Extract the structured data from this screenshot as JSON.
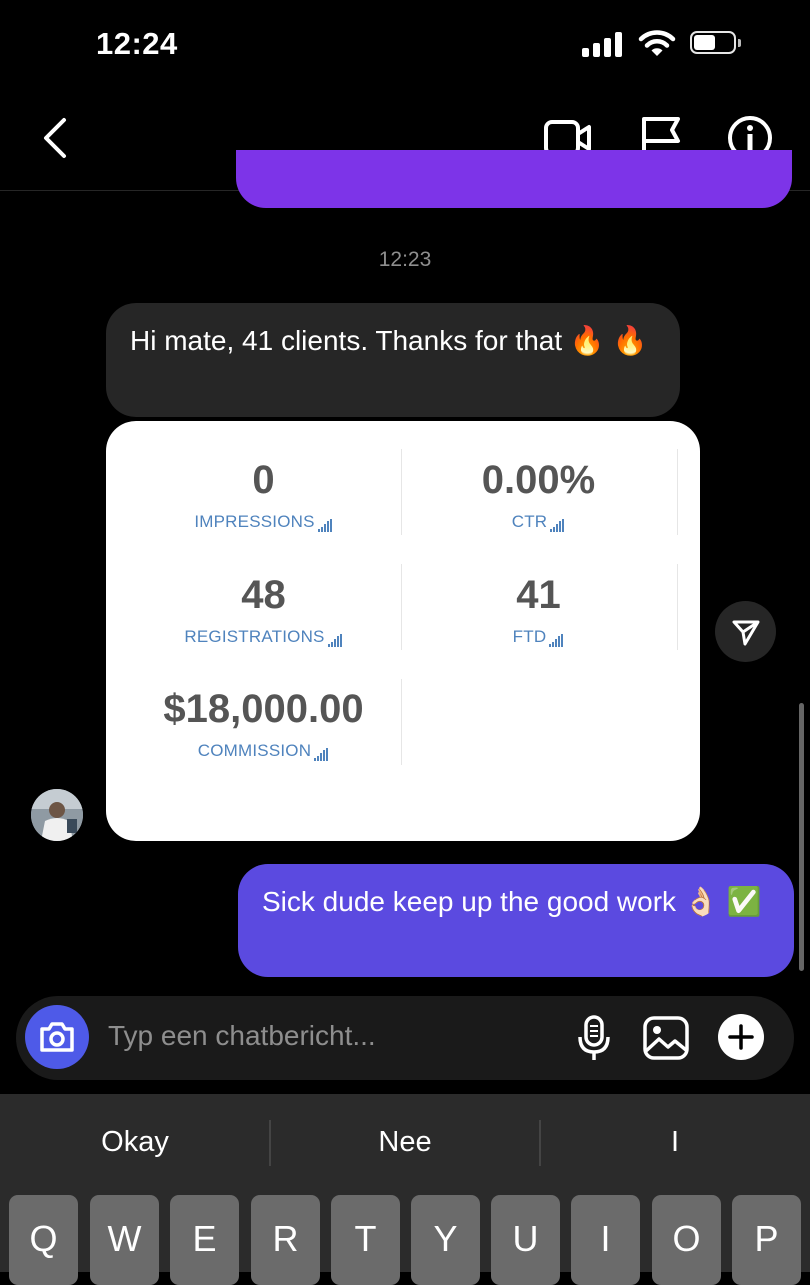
{
  "status_bar": {
    "time": "12:24"
  },
  "nav": {
    "back_icon": "chevron-left-icon",
    "video_icon": "video-camera-icon",
    "flag_icon": "flag-icon",
    "info_icon": "info-icon"
  },
  "chat": {
    "timestamp": "12:23",
    "incoming_message": "Hi mate, 41 clients. Thanks for that 🔥 🔥",
    "stats_card": {
      "impressions_value": "0",
      "impressions_label": "IMPRESSIONS",
      "ctr_value": "0.00%",
      "ctr_label": "CTR",
      "registrations_value": "48",
      "registrations_label": "REGISTRATIONS",
      "ftd_value": "41",
      "ftd_label": "FTD",
      "commission_value": "$18,000.00",
      "commission_label": "COMMISSION"
    },
    "outgoing_message": "Sick dude keep up the good work 👌🏻 ✅"
  },
  "composer": {
    "placeholder": "Typ een chatbericht..."
  },
  "keyboard": {
    "suggestions": [
      "Okay",
      "Nee",
      "I"
    ],
    "row1": [
      "Q",
      "W",
      "E",
      "R",
      "T",
      "Y",
      "U",
      "I",
      "O",
      "P"
    ]
  },
  "colors": {
    "outgoing_bubble": "#5b4ae0",
    "prev_bubble": "#7d34e8",
    "camera_button": "#4e5ae8",
    "stat_label": "#4f83bd"
  }
}
